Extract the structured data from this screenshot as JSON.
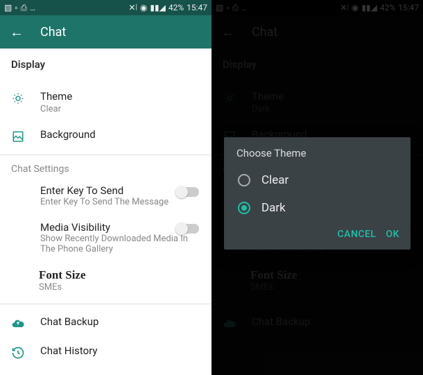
{
  "status": {
    "battery": "42%",
    "time": "15:47"
  },
  "appbar": {
    "title": "Chat"
  },
  "display": {
    "heading": "Display",
    "theme_label": "Theme",
    "theme_value_light": "Clear",
    "theme_value_dark": "Dark",
    "background_label": "Background"
  },
  "chat_settings": {
    "heading": "Chat Settings",
    "enter_key_title": "Enter Key To Send",
    "enter_key_sub": "Enter Key To Send The Message",
    "media_title": "Media Visibility",
    "media_sub": "Show Recently Downloaded Media In The Phone Gallery",
    "font_title": "Font Size",
    "font_value": "SMEs"
  },
  "other": {
    "backup": "Chat Backup",
    "history": "Chat History"
  },
  "dialog": {
    "title": "Choose Theme",
    "option_clear": "Clear",
    "option_dark": "Dark",
    "cancel": "CANCEL",
    "ok": "OK"
  }
}
